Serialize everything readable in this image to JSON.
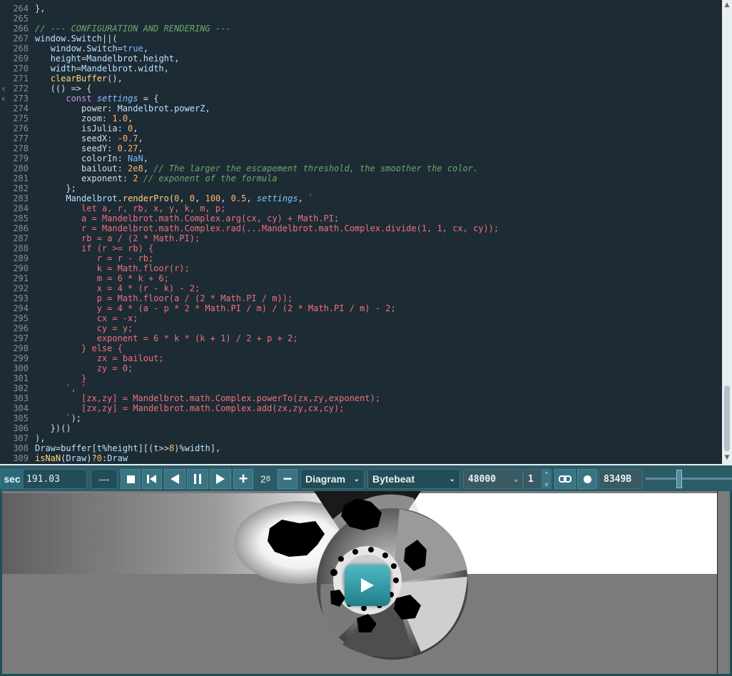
{
  "editor": {
    "lines": [
      {
        "n": "264",
        "html": "},"
      },
      {
        "n": "265",
        "html": ""
      },
      {
        "n": "266",
        "html": "<span class='cm'>// --- CONFIGURATION AND RENDERING ---</span>"
      },
      {
        "n": "267",
        "html": "<span class='id'>window</span>.<span class='id'>Switch</span>||("
      },
      {
        "n": "268",
        "html": "   <span class='id'>window</span>.<span class='id'>Switch</span>=<span class='bool'>true</span>,"
      },
      {
        "n": "269",
        "html": "   <span class='id'>height</span>=<span class='id'>Mandelbrot</span>.<span class='id'>height</span>,"
      },
      {
        "n": "270",
        "html": "   <span class='id'>width</span>=<span class='id'>Mandelbrot</span>.<span class='id'>width</span>,"
      },
      {
        "n": "271",
        "html": "   <span class='fn'>clearBuffer</span>(),"
      },
      {
        "n": "272",
        "fold": "v",
        "html": "   (() =&gt; {"
      },
      {
        "n": "273",
        "fold": "v",
        "html": "      <span class='kw'>const</span> <span class='var'>settings</span> = {"
      },
      {
        "n": "274",
        "html": "         power: <span class='id'>Mandelbrot</span>.<span class='id'>powerZ</span>,"
      },
      {
        "n": "275",
        "html": "         zoom: <span class='num'>1.0</span>,"
      },
      {
        "n": "276",
        "html": "         isJulia: <span class='num'>0</span>,"
      },
      {
        "n": "277",
        "html": "         seedX: <span class='num'>-0.7</span>,"
      },
      {
        "n": "278",
        "html": "         seedY: <span class='num'>0.27</span>,"
      },
      {
        "n": "279",
        "html": "         colorIn: <span class='bool'>NaN</span>,"
      },
      {
        "n": "280",
        "html": "         bailout: <span class='num'>2e8</span>, <span class='cm'>// The larger the escapement threshold, the smoother the color.</span>"
      },
      {
        "n": "281",
        "html": "         exponent: <span class='num'>2</span> <span class='cm'>// exponent of the formula</span>"
      },
      {
        "n": "282",
        "html": "      };"
      },
      {
        "n": "283",
        "html": "      <span class='id'>Mandelbrot</span>.<span class='fn'>renderPro</span>(<span class='num'>0</span>, <span class='num'>0</span>, <span class='num'>100</span>, <span class='num'>0.5</span>, <span class='var'>settings</span>, <span class='str'>`</span>"
      },
      {
        "n": "284",
        "html": "<span class='str'>         let a, r, rb, x, y, k, m, p;</span>"
      },
      {
        "n": "285",
        "html": "<span class='str'>         a = Mandelbrot.math.Complex.arg(cx, cy) + Math.PI;</span>"
      },
      {
        "n": "286",
        "html": "<span class='str'>         r = Mandelbrot.math.Complex.rad(...Mandelbrot.math.Complex.divide(1, 1, cx, cy));</span>"
      },
      {
        "n": "287",
        "html": "<span class='str'>         rb = a / (2 * Math.PI);</span>"
      },
      {
        "n": "288",
        "html": "<span class='str'>         if (r &gt;= rb) {</span>"
      },
      {
        "n": "289",
        "html": "<span class='str'>            r = r - rb;</span>"
      },
      {
        "n": "290",
        "html": "<span class='str'>            k = Math.floor(r);</span>"
      },
      {
        "n": "291",
        "html": "<span class='str'>            m = 6 * k + 6;</span>"
      },
      {
        "n": "292",
        "html": "<span class='str'>            x = 4 * (r - k) - 2;</span>"
      },
      {
        "n": "293",
        "html": "<span class='str'>            p = Math.floor(a / (2 * Math.PI / m));</span>"
      },
      {
        "n": "294",
        "html": "<span class='str'>            y = 4 * (a - p * 2 * Math.PI / m) / (2 * Math.PI / m) - 2;</span>"
      },
      {
        "n": "295",
        "html": "<span class='str'>            cx = -x;</span>"
      },
      {
        "n": "296",
        "html": "<span class='str'>            cy = y;</span>"
      },
      {
        "n": "297",
        "html": "<span class='str'>            exponent = 6 * k * (k + 1) / 2 + p + 2;</span>"
      },
      {
        "n": "298",
        "html": "<span class='str'>         } else {</span>"
      },
      {
        "n": "299",
        "html": "<span class='str'>            zx = bailout;</span>"
      },
      {
        "n": "300",
        "html": "<span class='str'>            zy = 0;</span>"
      },
      {
        "n": "301",
        "html": "<span class='str'>         }</span>"
      },
      {
        "n": "302",
        "html": "<span class='str'>      `, `</span>"
      },
      {
        "n": "303",
        "html": "<span class='str'>         [zx,zy] = Mandelbrot.math.Complex.powerTo(zx,zy,exponent);</span>"
      },
      {
        "n": "304",
        "html": "<span class='str'>         [zx,zy] = Mandelbrot.math.Complex.add(zx,zy,cx,cy);</span>"
      },
      {
        "n": "305",
        "html": "<span class='str'>      `</span>);"
      },
      {
        "n": "306",
        "html": "   })()"
      },
      {
        "n": "307",
        "html": "),"
      },
      {
        "n": "308",
        "html": "<span class='id'>Draw</span>=<span class='id'>buffer</span>[<span class='id'>t</span>%<span class='id'>height</span>][(<span class='id'>t</span>&gt;&gt;<span class='num'>8</span>)%<span class='id'>width</span>],"
      },
      {
        "n": "309",
        "html": "<span class='fn'>isNaN</span>(<span class='id'>Draw</span>)?<span class='num'>0</span>:<span class='id'>Draw</span>"
      }
    ]
  },
  "toolbar": {
    "time_unit": "sec",
    "time_value": "191.03",
    "dashes": "---",
    "speed_label": "2",
    "speed_exp": "8",
    "mode_select": "Diagram",
    "type_select": "Bytebeat",
    "samplerate": "48000",
    "divisor": "1",
    "size_label": "8349B"
  },
  "colors": {
    "editor_bg": "#1d2b35",
    "toolbar_bg": "#2a5b67",
    "accent": "#3a7483"
  },
  "icons": [
    "stop-icon",
    "rewind-icon",
    "step-back-icon",
    "pause-icon",
    "step-forward-icon",
    "plus-icon",
    "minus-icon",
    "link-icon",
    "record-icon",
    "play-icon"
  ]
}
